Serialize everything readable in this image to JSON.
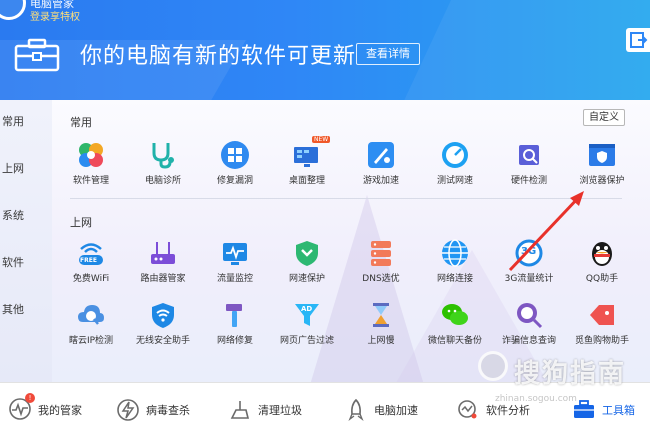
{
  "header": {
    "app_title": "电脑管家",
    "login_link": "登录享特权",
    "banner_text": "你的电脑有新的软件可更新",
    "view_details": "查看详情"
  },
  "sidebar": {
    "items": [
      "常用",
      "上网",
      "系统",
      "软件",
      "其他"
    ]
  },
  "sections": {
    "common": {
      "title": "常用",
      "tools": [
        "软件管理",
        "电脑诊所",
        "修复漏洞",
        "桌面整理",
        "游戏加速",
        "测试网速",
        "硬件检测",
        "浏览器保护"
      ]
    },
    "internet": {
      "title": "上网",
      "row1": [
        "免费WiFi",
        "路由器管家",
        "流量监控",
        "网速保护",
        "DNS选优",
        "网络连接",
        "3G流量统计",
        "QQ助手"
      ],
      "row2": [
        "瞎云IP检测",
        "无线安全助手",
        "网络修复",
        "网页广告过滤",
        "上网慢",
        "微信聊天备份",
        "诈骗信息查询",
        "觅鱼购物助手"
      ]
    }
  },
  "customize_label": "自定义",
  "new_badge": "NEW",
  "free_badge": "FREE",
  "ad_badge": "AD",
  "threeg_badge": "3G",
  "bottom_bar": {
    "items": [
      "我的管家",
      "病毒查杀",
      "清理垃圾",
      "电脑加速",
      "软件分析",
      "工具箱"
    ],
    "badge": "!"
  },
  "watermark": {
    "text": "搜狗指南",
    "sub": "zhinan.sogou.com"
  },
  "colors": {
    "header_blue": "#2a7af0",
    "accent_blue": "#1565e6",
    "arrow_red": "#e8312a"
  }
}
